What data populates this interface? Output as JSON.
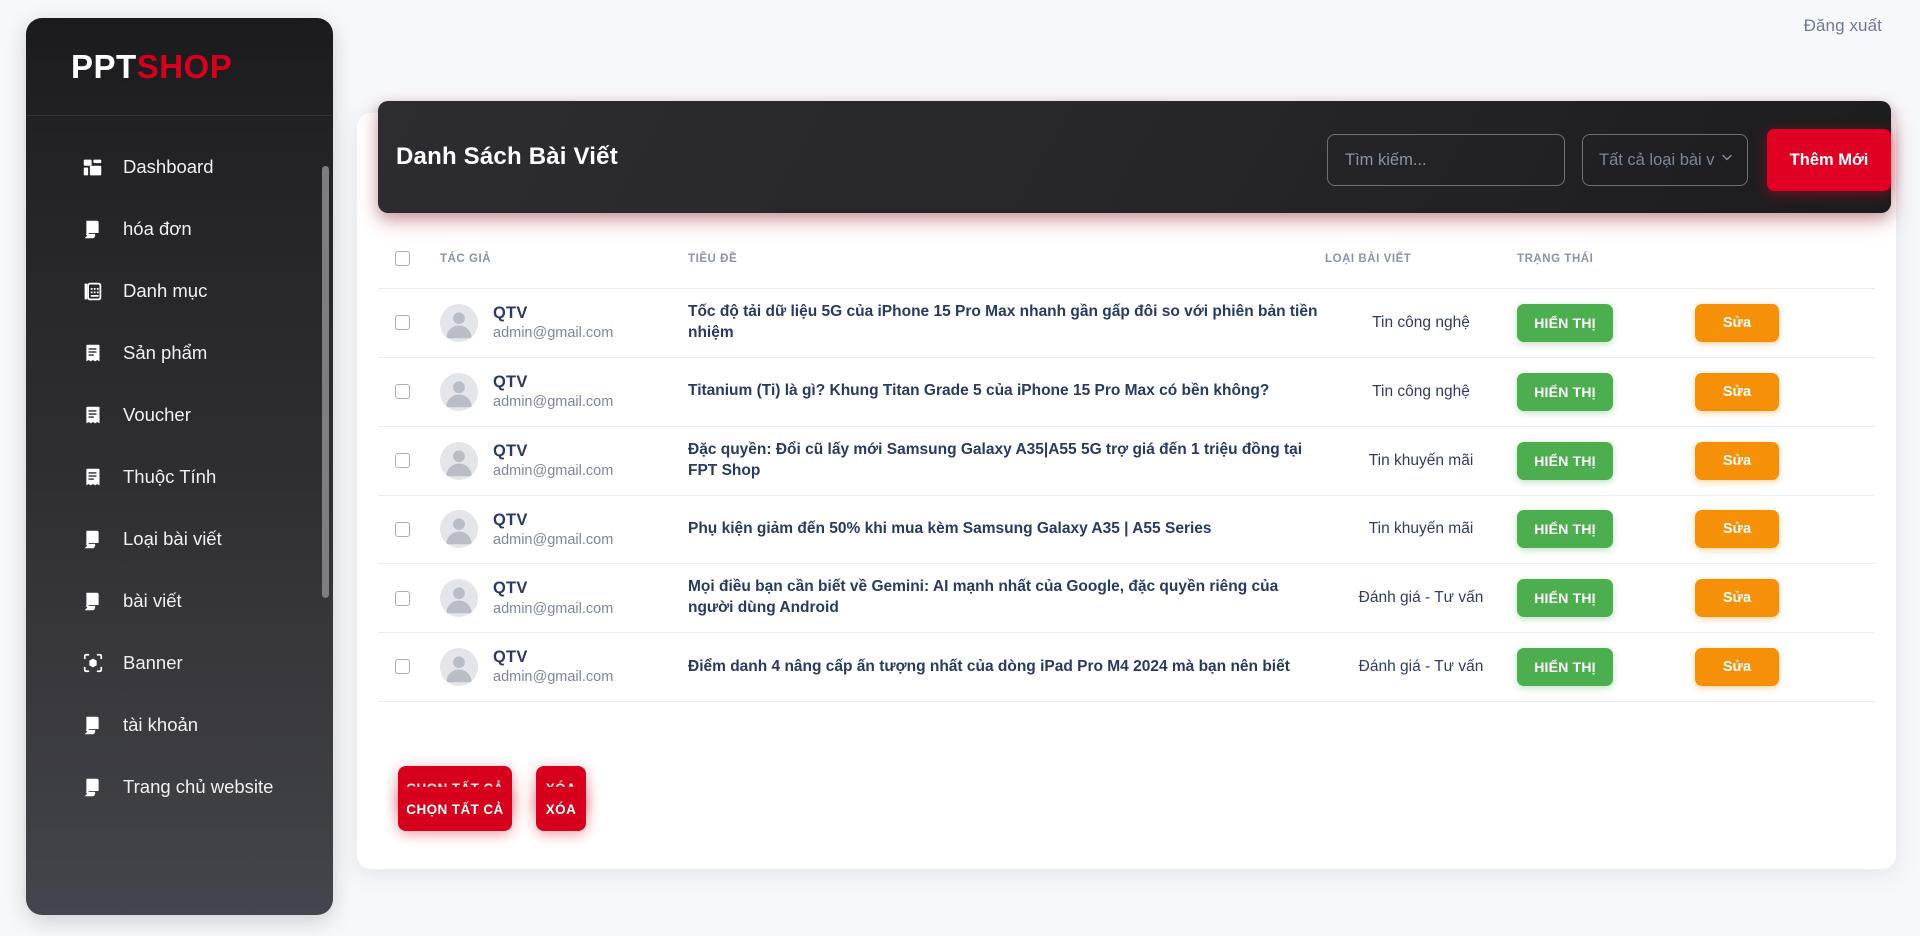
{
  "topbar": {
    "logout_label": "Đăng xuất"
  },
  "sidebar": {
    "brand": {
      "primary": "PPT",
      "accent": "SHOP",
      "accent_color": "#d6001c"
    },
    "items": [
      {
        "label": "Dashboard",
        "icon": "dashboard-grid-icon"
      },
      {
        "label": "hóa đơn",
        "icon": "invoice-icon"
      },
      {
        "label": "Danh mục",
        "icon": "category-icon"
      },
      {
        "label": "Sản phẩm",
        "icon": "product-icon"
      },
      {
        "label": "Voucher",
        "icon": "voucher-icon"
      },
      {
        "label": "Thuộc Tính",
        "icon": "attribute-icon"
      },
      {
        "label": "Loại bài viết",
        "icon": "invoice-icon"
      },
      {
        "label": "bài viết",
        "icon": "invoice-icon"
      },
      {
        "label": "Banner",
        "icon": "banner-scan-icon"
      },
      {
        "label": "tài khoản",
        "icon": "invoice-icon"
      },
      {
        "label": "Trang chủ website",
        "icon": "invoice-icon"
      }
    ]
  },
  "card": {
    "title": "Danh Sách Bài Viết",
    "search": {
      "value": "",
      "placeholder": "Tìm kiếm..."
    },
    "type_filter": {
      "selected": "Tất cả loại bài viết",
      "options": [
        "Tất cả loại bài viết",
        "Tin công nghệ",
        "Tin khuyến mãi",
        "Đánh giá - Tư vấn"
      ]
    },
    "add_button": "Thêm Mới"
  },
  "table": {
    "headers": {
      "author": "TÁC GIẢ",
      "title": "TIÊU ĐỀ",
      "type": "LOẠI BÀI VIẾT",
      "status": "TRẠNG THÁI"
    },
    "rows": [
      {
        "author_name": "QTV",
        "author_email": "admin@gmail.com",
        "title": "Tốc độ tải dữ liệu 5G của iPhone 15 Pro Max nhanh gần gấp đôi so với phiên bản tiền nhiệm",
        "type": "Tin công nghệ",
        "status": "HIỂN THỊ",
        "action": "Sửa"
      },
      {
        "author_name": "QTV",
        "author_email": "admin@gmail.com",
        "title": "Titanium (Ti) là gì? Khung Titan Grade 5 của iPhone 15 Pro Max có bền không?",
        "type": "Tin công nghệ",
        "status": "HIỂN THỊ",
        "action": "Sửa"
      },
      {
        "author_name": "QTV",
        "author_email": "admin@gmail.com",
        "title": "Đặc quyền: Đổi cũ lấy mới Samsung Galaxy A35|A55 5G trợ giá đến 1 triệu đồng tại FPT Shop",
        "type": "Tin khuyến mãi",
        "status": "HIỂN THỊ",
        "action": "Sửa"
      },
      {
        "author_name": "QTV",
        "author_email": "admin@gmail.com",
        "title": "Phụ kiện giảm đến 50% khi mua kèm Samsung Galaxy A35 | A55 Series",
        "type": "Tin khuyến mãi",
        "status": "HIỂN THỊ",
        "action": "Sửa"
      },
      {
        "author_name": "QTV",
        "author_email": "admin@gmail.com",
        "title": "Mọi điều bạn cần biết về Gemini: AI mạnh nhất của Google, đặc quyền riêng của người dùng Android",
        "type": "Đánh giá - Tư vấn",
        "status": "HIỂN THỊ",
        "action": "Sửa"
      },
      {
        "author_name": "QTV",
        "author_email": "admin@gmail.com",
        "title": "Điểm danh 4 nâng cấp ấn tượng nhất của dòng iPad Pro M4 2024 mà bạn nên biết",
        "type": "Đánh giá - Tư vấn",
        "status": "HIỂN THỊ",
        "action": "Sửa"
      }
    ]
  },
  "footer": {
    "select_all_label": "CHỌN TẤT CẢ",
    "delete_label": "XÓA"
  },
  "colors": {
    "brand_red": "#d6001c",
    "add_red": "#e00024",
    "status_green": "#4cae4f",
    "edit_orange": "#f79009",
    "sidebar_top": "#1b1b1d",
    "sidebar_bottom": "#45454d",
    "page_bg": "#f7f8fb"
  }
}
